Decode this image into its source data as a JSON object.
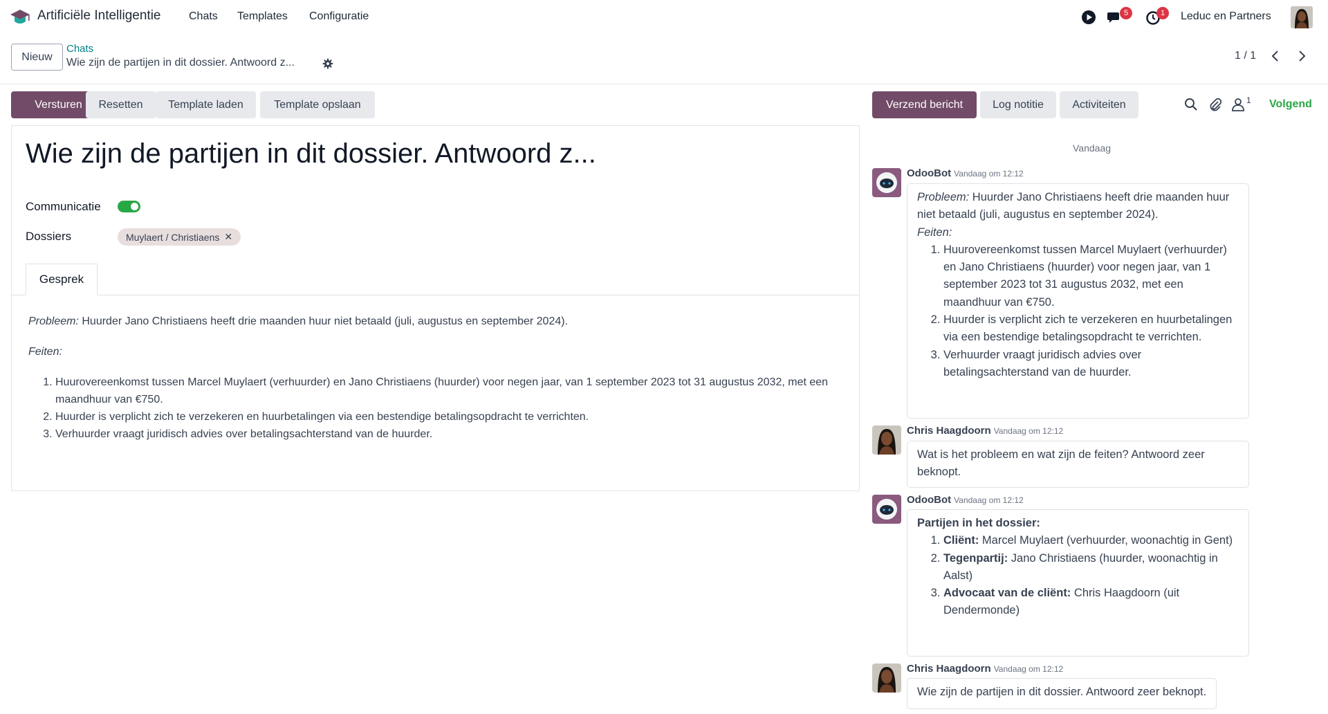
{
  "navbar": {
    "app_name": "Artificiële Intelligentie",
    "menus": [
      "Chats",
      "Templates",
      "Configuratie"
    ],
    "messages_count": "5",
    "activities_count": "1",
    "company": "Leduc en Partners"
  },
  "control_panel": {
    "new_label": "Nieuw",
    "breadcrumb_parent": "Chats",
    "breadcrumb_current": "Wie zijn de partijen in dit dossier. Antwoord z...",
    "pager": "1 / 1"
  },
  "actions": {
    "send": "Versturen",
    "reset": "Resetten",
    "load_template": "Template laden",
    "save_template": "Template opslaan"
  },
  "chatter_actions": {
    "send_message": "Verzend bericht",
    "log_note": "Log notitie",
    "activities": "Activiteiten",
    "followers_count": "1",
    "follow": "Volgend"
  },
  "form": {
    "title": "Wie zijn de partijen in dit dossier. Antwoord z...",
    "communication_label": "Communicatie",
    "communication_on": true,
    "dossiers_label": "Dossiers",
    "dossier_tag": "Muylaert / Christiaens",
    "tab_label": "Gesprek",
    "conversation": {
      "problem_label": "Probleem:",
      "problem_text": " Huurder Jano Christiaens heeft drie maanden huur niet betaald (juli, augustus en september 2024).",
      "facts_label": "Feiten:",
      "facts": [
        "Huurovereenkomst tussen Marcel Muylaert (verhuurder) en Jano Christiaens (huurder) voor negen jaar, van 1 september 2023 tot 31 augustus 2032, met een maandhuur van €750.",
        "Huurder is verplicht zich te verzekeren en huurbetalingen via een bestendige betalingsopdracht te verrichten.",
        "Verhuurder vraagt juridisch advies over betalingsachterstand van de huurder."
      ]
    }
  },
  "chatter": {
    "day": "Vandaag",
    "messages": [
      {
        "author": "OdooBot",
        "date": "Vandaag om 12:12",
        "problem_label": "Probleem:",
        "problem_text": " Huurder Jano Christiaens heeft drie maanden huur niet betaald (juli, augustus en september 2024).",
        "facts_label": "Feiten:",
        "facts": [
          "Huurovereenkomst tussen Marcel Muylaert (verhuurder) en Jano Christiaens (huurder) voor negen jaar, van 1 september 2023 tot 31 augustus 2032, met een maandhuur van €750.",
          "Huurder is verplicht zich te verzekeren en huurbetalingen via een bestendige betalingsopdracht te verrichten.",
          "Verhuurder vraagt juridisch advies over betalingsachterstand van de huurder."
        ]
      },
      {
        "author": "Chris Haagdoorn",
        "date": "Vandaag om 12:12",
        "text": "Wat is het probleem en wat zijn de feiten? Antwoord zeer beknopt."
      },
      {
        "author": "OdooBot",
        "date": "Vandaag om 12:12",
        "heading": "Partijen in het dossier:",
        "parties": [
          {
            "role": "Cliënt:",
            "text": " Marcel Muylaert (verhuurder, woonachtig in Gent)"
          },
          {
            "role": "Tegenpartij:",
            "text": " Jano Christiaens (huurder, woonachtig in Aalst)"
          },
          {
            "role": "Advocaat van de cliënt:",
            "text": " Chris Haagdoorn (uit Dendermonde)"
          }
        ]
      },
      {
        "author": "Chris Haagdoorn",
        "date": "Vandaag om 12:12",
        "text": "Wie zijn de partijen in dit dossier. Antwoord zeer beknopt."
      }
    ]
  },
  "colors": {
    "brand": "#714b67",
    "link": "#017e84",
    "success": "#28a745",
    "badge": "#dc3545"
  }
}
